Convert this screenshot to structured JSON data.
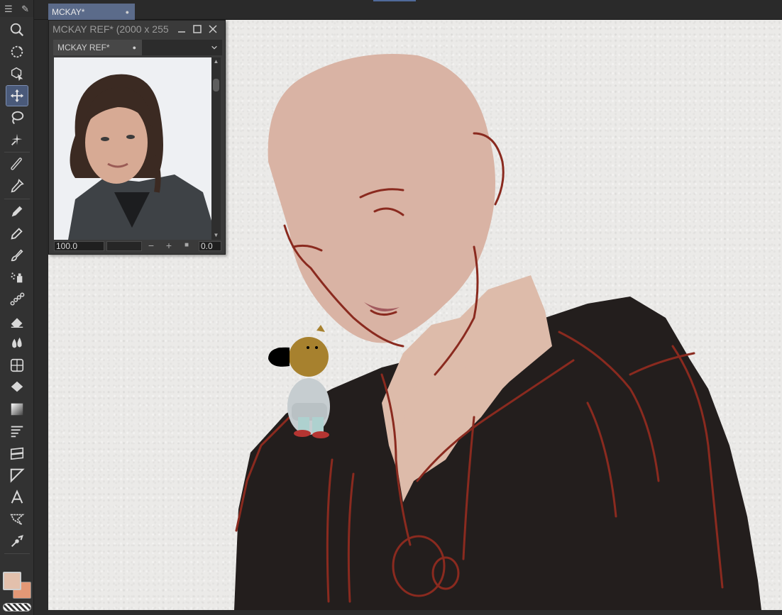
{
  "document_tab": {
    "label": "MCKAY*",
    "modified_dot": "●"
  },
  "reference_window": {
    "title": "MCKAY REF* (2000 x 255",
    "tab_label": "MCKAY REF*",
    "tab_dot": "●",
    "zoom_value": "100.0",
    "rotation_value": "0.0",
    "zoom_out_symbol": "−",
    "zoom_in_symbol": "+",
    "reset_symbol": "■"
  },
  "tools": [
    {
      "icon": "zoom-icon"
    },
    {
      "icon": "rotate-view-icon"
    },
    {
      "icon": "object-select-icon"
    },
    {
      "icon": "move-icon",
      "active": true
    },
    {
      "icon": "lasso-icon"
    },
    {
      "icon": "magic-wand-icon"
    },
    {
      "icon": "ruler-icon"
    },
    {
      "icon": "eyedropper-icon"
    },
    {
      "icon": "pen-icon"
    },
    {
      "icon": "pencil-icon"
    },
    {
      "icon": "brush-icon"
    },
    {
      "icon": "airbrush-icon"
    },
    {
      "icon": "decoration-icon"
    },
    {
      "icon": "eraser-icon"
    },
    {
      "icon": "blend-icon"
    },
    {
      "icon": "3d-figure-icon"
    },
    {
      "icon": "fill-icon"
    },
    {
      "icon": "gradient-icon"
    },
    {
      "icon": "frame-border-icon"
    },
    {
      "icon": "layer-move-icon"
    },
    {
      "icon": "figure-icon"
    },
    {
      "icon": "text-icon"
    },
    {
      "icon": "balloon-icon"
    },
    {
      "icon": "correct-line-icon"
    }
  ],
  "colors": {
    "main": "#e3c0ac",
    "sub": "#e39876",
    "accent": "#5b6b8a"
  }
}
